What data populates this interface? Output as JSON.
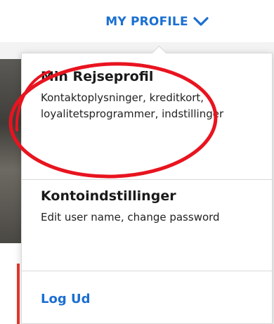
{
  "header": {
    "label": "MY PROFILE",
    "chevron_icon": "chevron-down-icon",
    "accent_color": "#1b6fd1"
  },
  "menu": {
    "profile": {
      "title": "Min Rejseprofil",
      "description": "Kontaktoplysninger, kreditkort, loyalitetsprogrammer, indstillinger"
    },
    "account": {
      "title": "Kontoindstillinger",
      "description": "Edit user name, change password"
    },
    "logout": {
      "label": "Log Ud"
    }
  },
  "annotation": {
    "shape": "hand-drawn-ellipse",
    "color": "#e8141f"
  }
}
